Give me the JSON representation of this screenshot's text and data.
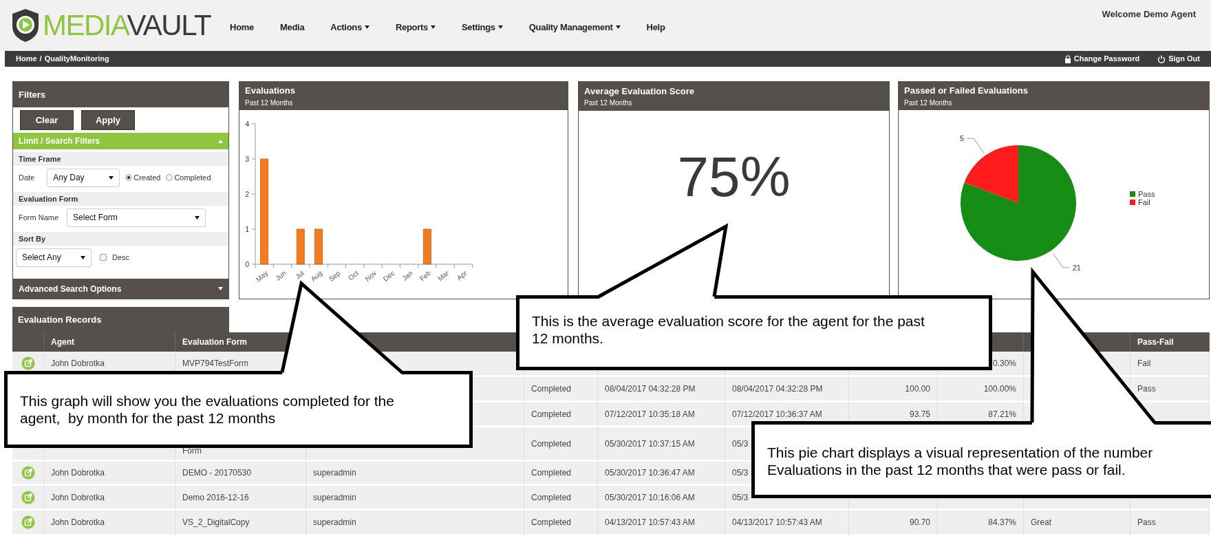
{
  "logo": {
    "accent": "MEDIA",
    "rest": "VAULT"
  },
  "nav": [
    {
      "label": "Home",
      "dropdown": false
    },
    {
      "label": "Media",
      "dropdown": false
    },
    {
      "label": "Actions",
      "dropdown": true
    },
    {
      "label": "Reports",
      "dropdown": true
    },
    {
      "label": "Settings",
      "dropdown": true
    },
    {
      "label": "Quality Management",
      "dropdown": true
    },
    {
      "label": "Help",
      "dropdown": false
    }
  ],
  "welcome": "Welcome Demo Agent",
  "breadcrumb": {
    "items": [
      "Home",
      "QualityMonitoring"
    ],
    "separator": "/"
  },
  "account_links": [
    {
      "kind": "lock",
      "label": "Change Password"
    },
    {
      "kind": "power",
      "label": "Sign Out"
    }
  ],
  "filters": {
    "title": "Filters",
    "buttons": [
      "Clear",
      "Apply"
    ],
    "limit_section": {
      "title": "Limit / Search Filters",
      "expanded": true
    },
    "time_frame": {
      "heading": "Time Frame",
      "label": "Date",
      "value": "Any Day",
      "options": [
        {
          "label": "Created",
          "selected": true
        },
        {
          "label": "Completed",
          "selected": false
        }
      ]
    },
    "evaluation_form": {
      "heading": "Evaluation Form",
      "label": "Form Name",
      "value": "Select Form"
    },
    "sort_by": {
      "heading": "Sort By",
      "value": "Select Any",
      "desc": {
        "label": "Desc",
        "checked": false
      }
    },
    "advanced_section": {
      "title": "Advanced Search Options",
      "expanded": false
    }
  },
  "cards": [
    {
      "kind": "bar",
      "title": "Evaluations",
      "subtitle": "Past 12 Months",
      "chart_data": {
        "type": "bar",
        "categories": [
          "May",
          "Jun",
          "Jul",
          "Aug",
          "Sep",
          "Oct",
          "Nov",
          "Dec",
          "Jan",
          "Feb",
          "Mar",
          "Apr"
        ],
        "values": [
          3,
          0,
          1,
          1,
          0,
          0,
          0,
          0,
          0,
          1,
          0,
          0
        ],
        "ylim": [
          0,
          4
        ],
        "yticks": [
          0,
          1,
          2,
          3,
          4
        ]
      }
    },
    {
      "kind": "score",
      "title": "Average Evaluation Score",
      "subtitle": "Past 12 Months",
      "value": "75%"
    },
    {
      "kind": "pie",
      "title": "Passed or Failed Evaluations",
      "subtitle": "Past 12 Months",
      "chart_data": {
        "type": "pie",
        "categories": [
          "Pass",
          "Fail"
        ],
        "values": [
          21,
          5
        ],
        "colors": [
          "#168e16",
          "#fe1c1c"
        ],
        "data_labels": true,
        "legend": "right"
      }
    }
  ],
  "records": {
    "title": "Evaluation Records",
    "columns": [
      "Agent",
      "Evaluation Form",
      "",
      "",
      "",
      "",
      "",
      "",
      "",
      "Pass-Fail"
    ],
    "rows": [
      {
        "icon": true,
        "cells": [
          "John Dobrotka",
          "MVP794TestForm",
          "",
          "",
          "",
          "",
          "",
          "0.30%",
          "",
          "Fail"
        ]
      },
      {
        "icon": false,
        "cells": [
          "",
          "",
          "",
          "Completed",
          "08/04/2017 04:32:28 PM",
          "08/04/2017 04:32:28 PM",
          "100.00",
          "100.00%",
          "",
          "Pass"
        ]
      },
      {
        "icon": false,
        "cells": [
          "",
          "",
          "",
          "Completed",
          "07/12/2017 10:35:18 AM",
          "07/12/2017 10:36:37 AM",
          "93.75",
          "87.21%",
          "",
          ""
        ]
      },
      {
        "icon": false,
        "cells": [
          "",
          "Form",
          "",
          "Completed",
          "05/30/2017 10:37:15 AM",
          "05/3",
          "",
          "",
          "",
          ""
        ]
      },
      {
        "icon": true,
        "cells": [
          "John Dobrotka",
          "DEMO - 20170530",
          "superadmin",
          "Completed",
          "05/30/2017 10:36:47 AM",
          "05/3",
          "",
          "",
          "",
          ""
        ]
      },
      {
        "icon": true,
        "cells": [
          "John Dobrotka",
          "Demo 2016-12-16",
          "superadmin",
          "Completed",
          "05/30/2017 10:16:06 AM",
          "05/3",
          "",
          "",
          "",
          ""
        ]
      },
      {
        "icon": true,
        "cells": [
          "John Dobrotka",
          "VS_2_DigitalCopy",
          "superadmin",
          "Completed",
          "04/13/2017 10:57:43 AM",
          "04/13/2017 10:57:43 AM",
          "90.70",
          "84.37%",
          "Great",
          "Pass"
        ]
      }
    ]
  },
  "callouts": [
    {
      "lines": [
        "This is the average evaluation score for the agent for the past",
        "12 months."
      ]
    },
    {
      "lines": [
        "This graph will show you the evaluations completed for the",
        "agent,  by month for the past 12 months"
      ]
    },
    {
      "lines": [
        "This pie chart displays a visual representation of the number",
        "Evaluations in the past 12 months that were pass or fail."
      ]
    }
  ]
}
